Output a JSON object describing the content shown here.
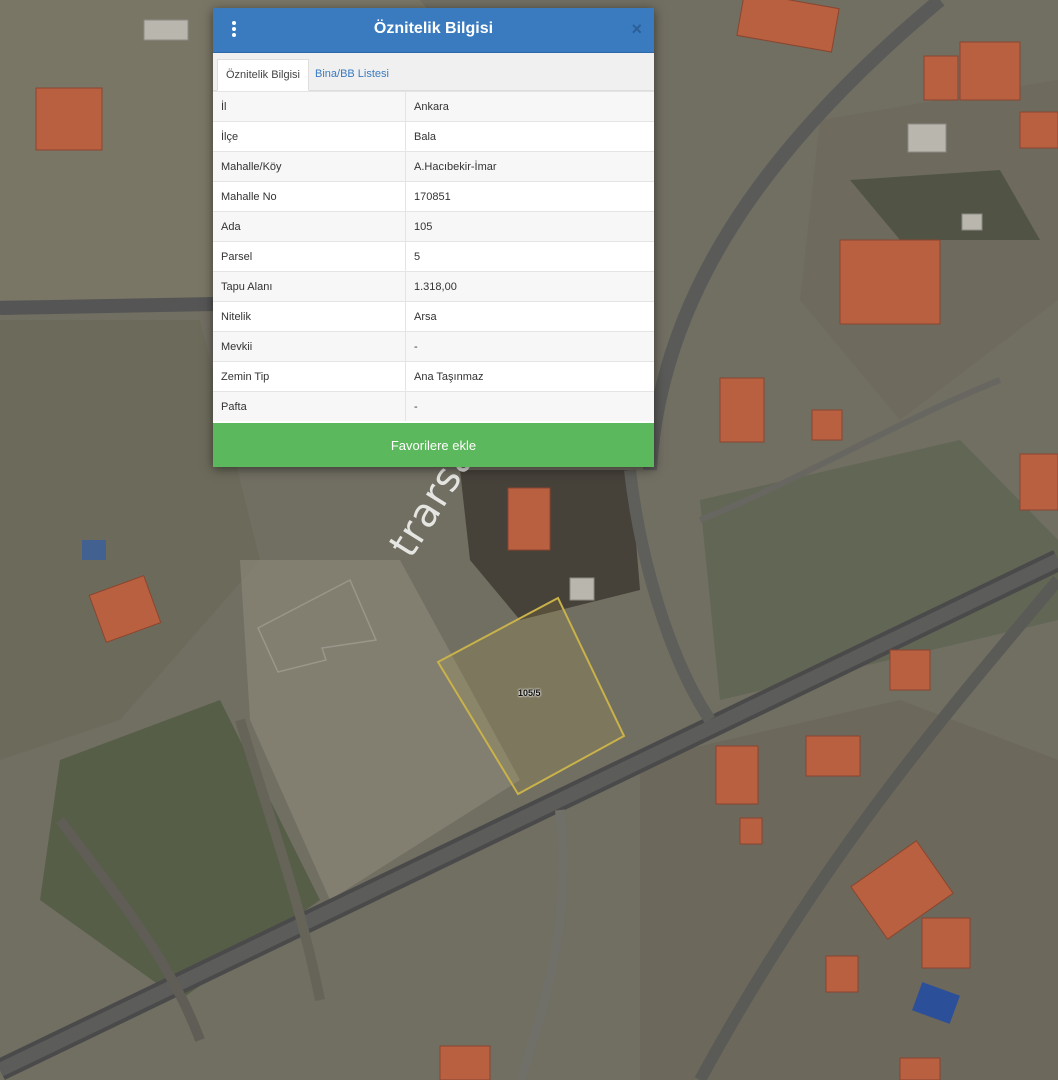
{
  "dialog": {
    "title": "Öznitelik Bilgisi",
    "close_symbol": "×",
    "menu_icon": "vertical-ellipsis-icon",
    "tabs": [
      {
        "label": "Öznitelik Bilgisi",
        "active": true
      },
      {
        "label": "Bina/BB Listesi",
        "active": false
      }
    ],
    "rows": [
      {
        "key": "İl",
        "value": "Ankara"
      },
      {
        "key": "İlçe",
        "value": "Bala"
      },
      {
        "key": "Mahalle/Köy",
        "value": "A.Hacıbekir-İmar"
      },
      {
        "key": "Mahalle No",
        "value": "170851"
      },
      {
        "key": "Ada",
        "value": "105"
      },
      {
        "key": "Parsel",
        "value": "5"
      },
      {
        "key": "Tapu Alanı",
        "value": "1.318,00"
      },
      {
        "key": "Nitelik",
        "value": "Arsa"
      },
      {
        "key": "Mevkii",
        "value": "-"
      },
      {
        "key": "Zemin Tip",
        "value": "Ana Taşınmaz"
      },
      {
        "key": "Pafta",
        "value": "-"
      }
    ],
    "favorite_button": "Favorilere ekle"
  },
  "map": {
    "parcel_label": "105/5",
    "watermark": "trarsa.com.tr"
  },
  "colors": {
    "header": "#3a7bc0",
    "favorite_button": "#5cb85c",
    "parcel_outline": "#c9b24a"
  }
}
